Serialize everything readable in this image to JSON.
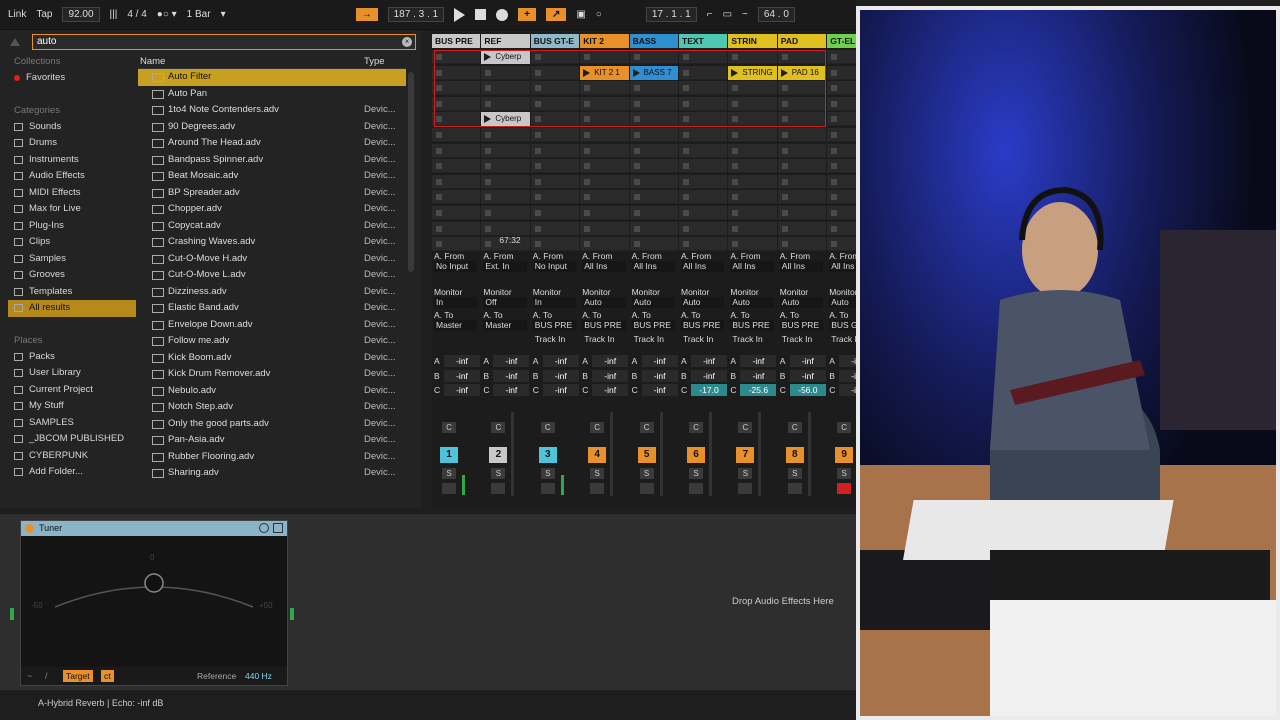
{
  "topbar": {
    "link": "Link",
    "tap": "Tap",
    "tempo": "92.00",
    "signature": "4 / 4",
    "quantize": "1 Bar",
    "position": "187 .   3 .   1",
    "loop_start": "17 .   1 .   1",
    "loop_length": "64 .   0"
  },
  "browser": {
    "search_value": "auto",
    "collections_head": "Collections",
    "favorites": "Favorites",
    "categories_head": "Categories",
    "categories": [
      "Sounds",
      "Drums",
      "Instruments",
      "Audio Effects",
      "MIDI Effects",
      "Max for Live",
      "Plug-Ins",
      "Clips",
      "Samples",
      "Grooves",
      "Templates",
      "All results"
    ],
    "places_head": "Places",
    "places": [
      "Packs",
      "User Library",
      "Current Project",
      "My Stuff",
      "SAMPLES",
      "_JBCOM PUBLISHED",
      "CYBERPUNK",
      "Add Folder..."
    ],
    "col_name": "Name",
    "col_type": "Type",
    "files": [
      {
        "name": "Auto Filter",
        "type": ""
      },
      {
        "name": "Auto Pan",
        "type": ""
      },
      {
        "name": "1to4 Note Contenders.adv",
        "type": "Devic..."
      },
      {
        "name": "90 Degrees.adv",
        "type": "Devic..."
      },
      {
        "name": "Around The Head.adv",
        "type": "Devic..."
      },
      {
        "name": "Bandpass Spinner.adv",
        "type": "Devic..."
      },
      {
        "name": "Beat Mosaic.adv",
        "type": "Devic..."
      },
      {
        "name": "BP Spreader.adv",
        "type": "Devic..."
      },
      {
        "name": "Chopper.adv",
        "type": "Devic..."
      },
      {
        "name": "Copycat.adv",
        "type": "Devic..."
      },
      {
        "name": "Crashing Waves.adv",
        "type": "Devic..."
      },
      {
        "name": "Cut-O-Move H.adv",
        "type": "Devic..."
      },
      {
        "name": "Cut-O-Move L.adv",
        "type": "Devic..."
      },
      {
        "name": "Dizziness.adv",
        "type": "Devic..."
      },
      {
        "name": "Elastic Band.adv",
        "type": "Devic..."
      },
      {
        "name": "Envelope Down.adv",
        "type": "Devic..."
      },
      {
        "name": "Follow me.adv",
        "type": "Devic..."
      },
      {
        "name": "Kick Boom.adv",
        "type": "Devic..."
      },
      {
        "name": "Kick Drum Remover.adv",
        "type": "Devic..."
      },
      {
        "name": "Nebulo.adv",
        "type": "Devic..."
      },
      {
        "name": "Notch Step.adv",
        "type": "Devic..."
      },
      {
        "name": "Only the good parts.adv",
        "type": "Devic..."
      },
      {
        "name": "Pan-Asia.adv",
        "type": "Devic..."
      },
      {
        "name": "Rubber Flooring.adv",
        "type": "Devic..."
      },
      {
        "name": "Sharing.adv",
        "type": "Devic..."
      }
    ]
  },
  "tracks": [
    {
      "name": "BUS PRE",
      "color": "#c8c8c8",
      "num": "1",
      "num_color": "#4fc3d9",
      "from": "No Input",
      "monitor": "In",
      "to": "Master",
      "send_c": "-inf"
    },
    {
      "name": "REF",
      "color": "#c8c8c8",
      "num": "2",
      "num_color": "#c8c8c8",
      "from": "Ext. In",
      "monitor": "Off",
      "to": "Master",
      "send_c": "-inf"
    },
    {
      "name": "BUS GT-E",
      "color": "#8fb8c8",
      "num": "3",
      "num_color": "#4fc3d9",
      "from": "No Input",
      "monitor": "In",
      "to": "BUS PRE",
      "send_c": "-inf"
    },
    {
      "name": "KIT 2",
      "color": "#e8902a",
      "num": "4",
      "num_color": "#e8902a",
      "from": "All Ins",
      "monitor": "Auto",
      "to": "BUS PRE",
      "send_c": "-inf"
    },
    {
      "name": "BASS",
      "color": "#2f8fd0",
      "num": "5",
      "num_color": "#e8902a",
      "from": "All Ins",
      "monitor": "Auto",
      "to": "BUS PRE",
      "send_c": "-inf"
    },
    {
      "name": "TEXT",
      "color": "#4ec8b0",
      "num": "6",
      "num_color": "#e8902a",
      "from": "All Ins",
      "monitor": "Auto",
      "to": "BUS PRE",
      "send_c": "-17.0"
    },
    {
      "name": "STRIN",
      "color": "#e0c020",
      "num": "7",
      "num_color": "#e8902a",
      "from": "All Ins",
      "monitor": "Auto",
      "to": "BUS PRE",
      "send_c": "-25.6"
    },
    {
      "name": "PAD",
      "color": "#e0c020",
      "num": "8",
      "num_color": "#e8902a",
      "from": "All Ins",
      "monitor": "Auto",
      "to": "BUS PRE",
      "send_c": "-56.0"
    },
    {
      "name": "GT-EL",
      "color": "#6fd050",
      "num": "9",
      "num_color": "#e8902a",
      "from": "All Ins",
      "monitor": "Auto",
      "to": "BUS GT",
      "send_c": "-inf"
    }
  ],
  "clips": {
    "ref_clip": "Cyberp",
    "ref_clip2": "Cyberp",
    "kit_clip": "KIT 2 1",
    "bass_clip": "BASS 7",
    "strings_clip": "STRING",
    "pad_clip": "PAD 16"
  },
  "labels": {
    "a_from": "A. From",
    "monitor": "Monitor",
    "a_to": "A. To",
    "track_in": "Track In",
    "ref_time": "67:32",
    "inf": "-inf",
    "c_label": "C",
    "s_label": "S",
    "send_a": "A",
    "send_b": "B",
    "send_c": "C"
  },
  "tuner": {
    "title": "Tuner",
    "zero": "0",
    "minus": "-50",
    "plus": "+50",
    "target": "Target",
    "ct": "ct",
    "reference_label": "Reference",
    "reference_value": "440 Hz"
  },
  "device_area": {
    "drop_text": "Drop Audio Effects Here"
  },
  "statusbar": {
    "text": "A-Hybrid Reverb | Echo: -inf dB"
  }
}
